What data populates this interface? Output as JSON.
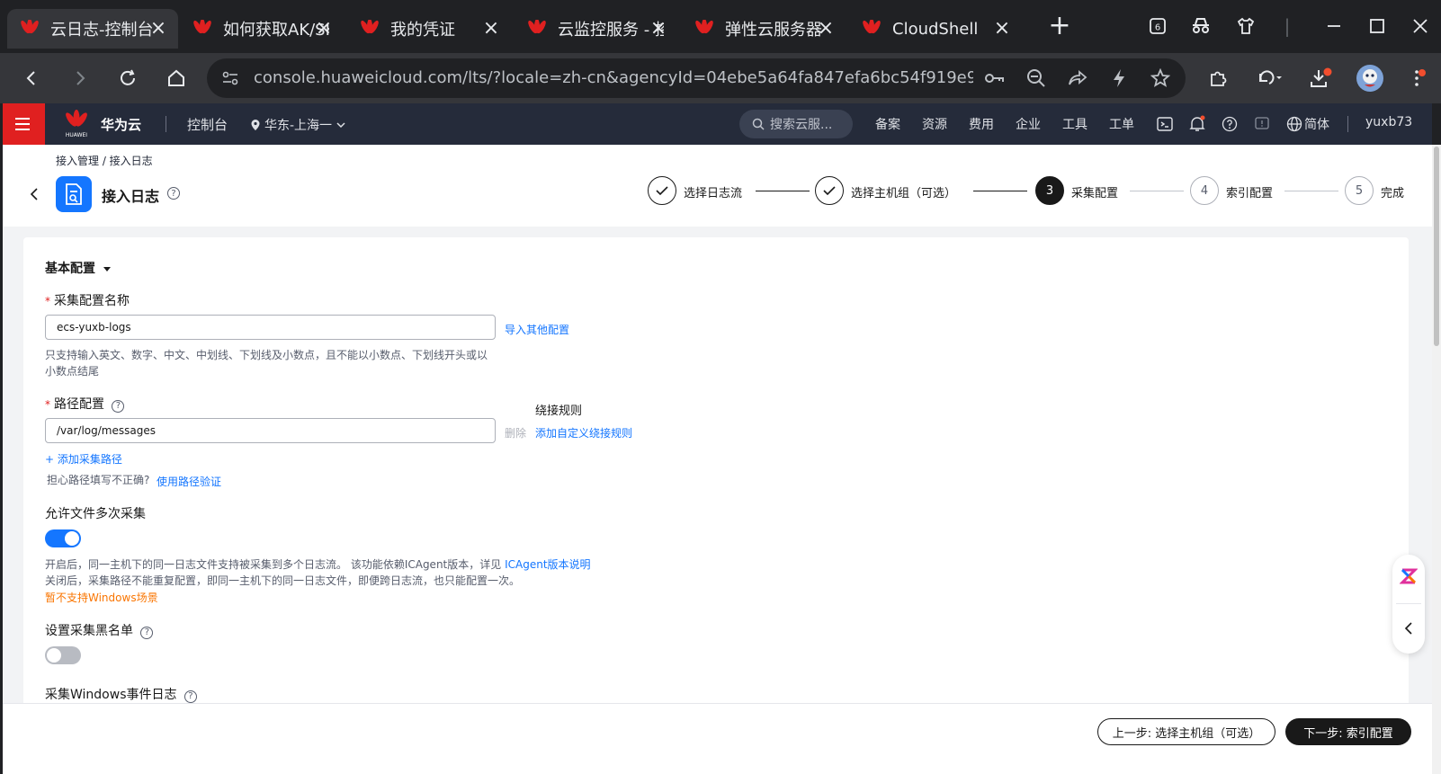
{
  "browser": {
    "tabs": [
      {
        "title": "云日志-控制台",
        "active": true
      },
      {
        "title": "如何获取AK/SK",
        "active": false
      },
      {
        "title": "我的凭证",
        "active": false
      },
      {
        "title": "云监控服务 - 控制台",
        "active": false
      },
      {
        "title": "弹性云服务器",
        "active": false
      },
      {
        "title": "CloudShell",
        "active": false
      }
    ],
    "tab_count_badge": "6",
    "url": "console.huaweicloud.com/lts/?locale=zh-cn&agencyId=04ebe5a64fa847efa6bc54f919e93..."
  },
  "header": {
    "brand": "华为云",
    "brand_logo_text": "HUAWEI",
    "console": "控制台",
    "region": "华东-上海一",
    "search_placeholder": "搜索云服...",
    "nav": [
      "备案",
      "资源",
      "费用",
      "企业",
      "工具",
      "工单"
    ],
    "language": "简体",
    "user": "yuxb73"
  },
  "page": {
    "breadcrumb": "接入管理 / 接入日志",
    "title": "接入日志",
    "steps": [
      {
        "num": "1",
        "label": "选择日志流",
        "state": "done"
      },
      {
        "num": "2",
        "label": "选择主机组（可选）",
        "state": "done"
      },
      {
        "num": "3",
        "label": "采集配置",
        "state": "current"
      },
      {
        "num": "4",
        "label": "索引配置",
        "state": "todo"
      },
      {
        "num": "5",
        "label": "完成",
        "state": "todo"
      }
    ]
  },
  "form": {
    "section_title": "基本配置",
    "name_label": "采集配置名称",
    "name_value": "ecs-yuxb-logs",
    "import_link": "导入其他配置",
    "name_hint_line1": "只支持输入英文、数字、中文、中划线、下划线及小数点，且不能以小数点、下划线开头或以",
    "name_hint_line2": "小数点结尾",
    "path_label": "路径配置",
    "path_value": "/var/log/messages",
    "bypass_label": "绕接规则",
    "delete_label": "删除",
    "add_bypass_link": "添加自定义绕接规则",
    "add_path_link": "+ 添加采集路径",
    "verify_hint": "担心路径填写不正确?",
    "verify_link": "使用路径验证",
    "multi_label": "允许文件多次采集",
    "multi_on": true,
    "multi_hint1": "开启后，同一主机下的同一日志文件支持被采集到多个日志流。 该功能依赖ICAgent版本，详见",
    "multi_hint1_link": "ICAgent版本说明",
    "multi_hint2": "关闭后，采集路径不能重复配置，即同一主机下的同一日志文件，即便跨日志流，也只能配置一次。",
    "multi_warn": "暂不支持Windows场景",
    "blacklist_label": "设置采集黑名单",
    "blacklist_on": false,
    "windows_label": "采集Windows事件日志"
  },
  "footer": {
    "prev": "上一步: 选择主机组（可选）",
    "next": "下一步: 索引配置"
  },
  "colors": {
    "accent": "#1476ff",
    "console_header": "#252b3a",
    "brand_red": "#e02020",
    "warning": "#fa7500"
  }
}
